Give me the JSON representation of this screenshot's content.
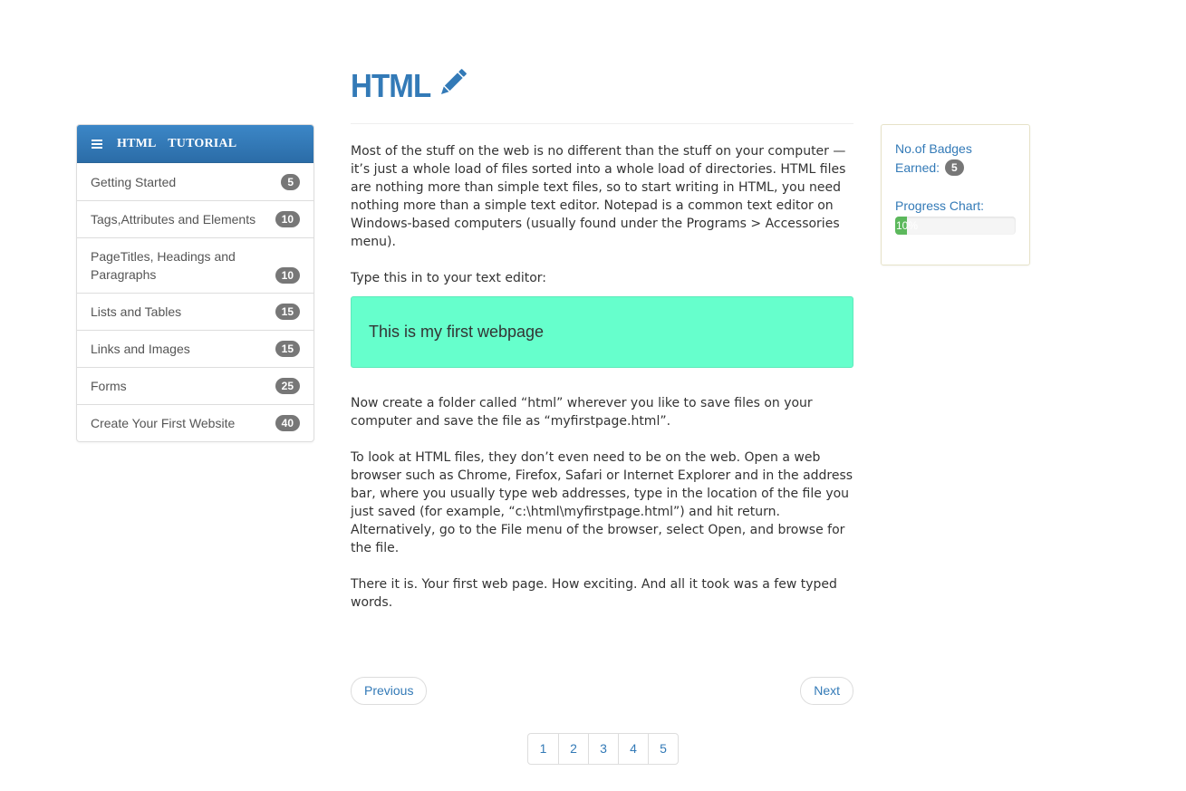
{
  "sidebar": {
    "title": "HTML TUTORIAL",
    "items": [
      {
        "label": "Getting Started",
        "count": "5"
      },
      {
        "label": "Tags,Attributes and Elements",
        "count": "10"
      },
      {
        "label": "PageTitles, Headings and Paragraphs",
        "count": "10"
      },
      {
        "label": "Lists and Tables",
        "count": "15"
      },
      {
        "label": "Links and Images",
        "count": "15"
      },
      {
        "label": "Forms",
        "count": "25"
      },
      {
        "label": "Create Your First Website",
        "count": "40"
      }
    ]
  },
  "main": {
    "title": "HTML",
    "title_icon": "pencil-icon",
    "paragraphs": [
      "Most of the stuff on the web is no different than the stuff on your computer — it’s just a whole load of files sorted into a whole load of directories. HTML files are nothing more than simple text files, so to start writing in HTML, you need nothing more than a simple text editor. Notepad is a common text editor on Windows-based computers (usually found under the Programs > Accessories menu).",
      "Type this in to your text editor:",
      "Now create a folder called “html” wherever you like to save files on your computer and save the file as “myfirstpage.html”.",
      "To look at HTML files, they don’t even need to be on the web. Open a web browser such as Chrome, Firefox, Safari or Internet Explorer and in the address bar, where you usually type web addresses, type in the location of the file you just saved (for example, “c:\\html\\myfirstpage.html”) and hit return. Alternatively, go to the File menu of the browser, select Open, and browse for the file.",
      "There it is. Your first web page. How exciting. And all it took was a few typed words."
    ],
    "example_text": "This is my first webpage",
    "prev_label": "Previous",
    "next_label": "Next",
    "pages": [
      "1",
      "2",
      "3",
      "4",
      "5"
    ]
  },
  "stats": {
    "badges_label": "No.of Badges Earned:",
    "badges_count": "5",
    "progress_label": "Progress Chart:",
    "progress_text": "10%",
    "progress_value": 0.1
  },
  "colors": {
    "accent": "#337ab7",
    "example_bg": "#66ffcc",
    "progress": "#5cb85c",
    "badge": "#777777"
  }
}
